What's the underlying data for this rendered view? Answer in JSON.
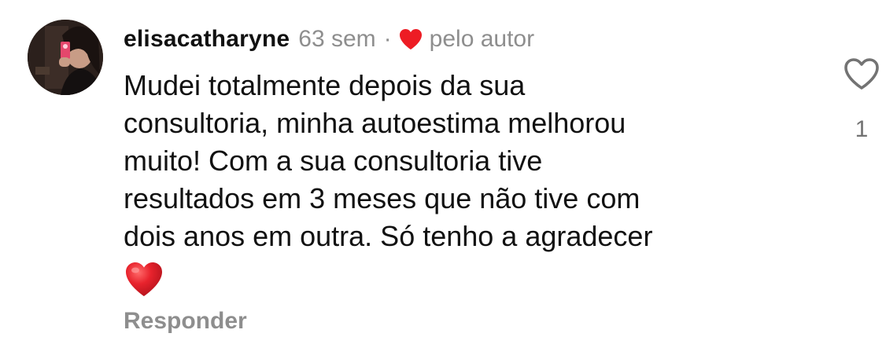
{
  "comment": {
    "username": "elisacatharyne",
    "time": "63 sem",
    "separator": "·",
    "author_badge_icon": "red-heart-icon",
    "author_badge_label": "pelo autor",
    "text_lines": [
      "Mudei totalmente depois da sua",
      "consultoria, minha autoestima melhorou",
      "muito! Com a sua consultoria tive",
      "resultados em 3 meses que não tive com",
      "dois anos em outra. Só tenho a agradecer"
    ],
    "emoji": "red-heart-emoji",
    "reply_label": "Responder",
    "like_icon": "heart-outline-icon",
    "like_count": "1"
  },
  "colors": {
    "text": "#111111",
    "muted": "#8e8e8e",
    "heart_red": "#ed1c24",
    "like_outline": "#737373"
  }
}
